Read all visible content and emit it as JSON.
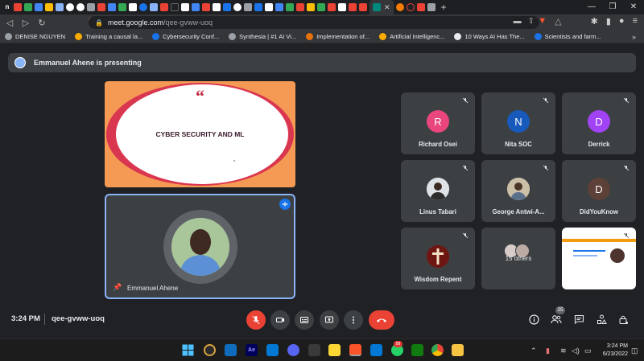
{
  "browser": {
    "url_host": "meet.google.com",
    "url_path": "/qee-gvww-uoq",
    "bookmarks": [
      {
        "label": "DENISE NGUYEN",
        "color": "#9aa0a6"
      },
      {
        "label": "Training a causal la...",
        "color": "#f9ab00"
      },
      {
        "label": "Cybersecurity Conf...",
        "color": "#1a73e8"
      },
      {
        "label": "Synthesia | #1 AI Vi...",
        "color": "#9aa0a6"
      },
      {
        "label": "Implementation of...",
        "color": "#e8710a"
      },
      {
        "label": "Artificial Intelligenc...",
        "color": "#f9ab00"
      },
      {
        "label": "10 Ways AI Has The...",
        "color": "#e8eaed"
      },
      {
        "label": "Scientists and farm...",
        "color": "#1a73e8"
      }
    ]
  },
  "meet": {
    "presenting_text": "Emmanuel Ahene is presenting",
    "slide": {
      "quote_mark": "“",
      "title": "CYBER SECURITY AND ML"
    },
    "self_tile": {
      "name": "Emmanuel Ahene"
    },
    "participants": [
      {
        "name": "Richard Osei",
        "initial": "R",
        "color": "#e8467c"
      },
      {
        "name": "Nita SOC",
        "initial": "N",
        "color": "#185abc"
      },
      {
        "name": "Derrick",
        "initial": "D",
        "color": "#a142f4"
      },
      {
        "name": "Linus Tabari",
        "initial": "",
        "color": "#6d7b5a"
      },
      {
        "name": "George Antwi-A...",
        "initial": "",
        "color": "#7a6a55"
      },
      {
        "name": "DidYouKnow",
        "initial": "D",
        "color": "#5d4037"
      },
      {
        "name": "Wisdom Repent",
        "initial": "",
        "color": "#8c1d18"
      },
      {
        "name": "15 others",
        "initial": "",
        "color": "#3c4043"
      }
    ],
    "time": "3:24 PM",
    "meeting_code": "qee-gvww-uoq",
    "people_count": "25"
  },
  "taskbar": {
    "clock_time": "3:24 PM",
    "clock_date": "6/23/2022",
    "notif_count": "99"
  }
}
